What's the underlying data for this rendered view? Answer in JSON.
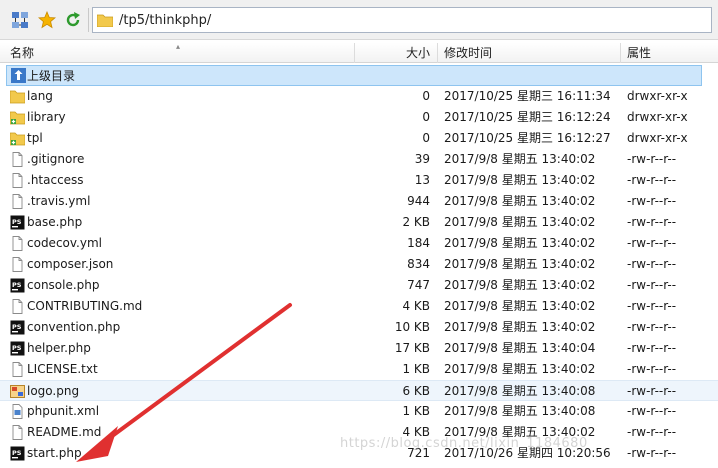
{
  "toolbar": {
    "path": "/tp5/thinkphp/",
    "icons": [
      "network-tree-icon",
      "favorite-star-icon",
      "refresh-icon",
      "folder-icon"
    ]
  },
  "columns": {
    "name": "名称",
    "size": "大小",
    "modified": "修改时间",
    "attributes": "属性"
  },
  "parent_dir": {
    "label": "上级目录"
  },
  "files": [
    {
      "name": "lang",
      "size": "0",
      "modified": "2017/10/25 星期三 16:11:34",
      "attr": "drwxr-xr-x",
      "icon": "folder"
    },
    {
      "name": "library",
      "size": "0",
      "modified": "2017/10/25 星期三 16:12:24",
      "attr": "drwxr-xr-x",
      "icon": "folder-plus"
    },
    {
      "name": "tpl",
      "size": "0",
      "modified": "2017/10/25 星期三 16:12:27",
      "attr": "drwxr-xr-x",
      "icon": "folder-plus"
    },
    {
      "name": ".gitignore",
      "size": "39",
      "modified": "2017/9/8 星期五 13:40:02",
      "attr": "-rw-r--r--",
      "icon": "file"
    },
    {
      "name": ".htaccess",
      "size": "13",
      "modified": "2017/9/8 星期五 13:40:02",
      "attr": "-rw-r--r--",
      "icon": "file"
    },
    {
      "name": ".travis.yml",
      "size": "944",
      "modified": "2017/9/8 星期五 13:40:02",
      "attr": "-rw-r--r--",
      "icon": "file"
    },
    {
      "name": "base.php",
      "size": "2 KB",
      "modified": "2017/9/8 星期五 13:40:02",
      "attr": "-rw-r--r--",
      "icon": "ps"
    },
    {
      "name": "codecov.yml",
      "size": "184",
      "modified": "2017/9/8 星期五 13:40:02",
      "attr": "-rw-r--r--",
      "icon": "file"
    },
    {
      "name": "composer.json",
      "size": "834",
      "modified": "2017/9/8 星期五 13:40:02",
      "attr": "-rw-r--r--",
      "icon": "file"
    },
    {
      "name": "console.php",
      "size": "747",
      "modified": "2017/9/8 星期五 13:40:02",
      "attr": "-rw-r--r--",
      "icon": "ps"
    },
    {
      "name": "CONTRIBUTING.md",
      "size": "4 KB",
      "modified": "2017/9/8 星期五 13:40:02",
      "attr": "-rw-r--r--",
      "icon": "file"
    },
    {
      "name": "convention.php",
      "size": "10 KB",
      "modified": "2017/9/8 星期五 13:40:02",
      "attr": "-rw-r--r--",
      "icon": "ps"
    },
    {
      "name": "helper.php",
      "size": "17 KB",
      "modified": "2017/9/8 星期五 13:40:04",
      "attr": "-rw-r--r--",
      "icon": "ps"
    },
    {
      "name": "LICENSE.txt",
      "size": "1 KB",
      "modified": "2017/9/8 星期五 13:40:02",
      "attr": "-rw-r--r--",
      "icon": "file"
    },
    {
      "name": "logo.png",
      "size": "6 KB",
      "modified": "2017/9/8 星期五 13:40:08",
      "attr": "-rw-r--r--",
      "icon": "image",
      "hover": true
    },
    {
      "name": "phpunit.xml",
      "size": "1 KB",
      "modified": "2017/9/8 星期五 13:40:08",
      "attr": "-rw-r--r--",
      "icon": "xml"
    },
    {
      "name": "README.md",
      "size": "4 KB",
      "modified": "2017/9/8 星期五 13:40:02",
      "attr": "-rw-r--r--",
      "icon": "file"
    },
    {
      "name": "start.php",
      "size": "721",
      "modified": "2017/10/26 星期四 10:20:56",
      "attr": "-rw-r--r--",
      "icon": "ps"
    }
  ],
  "watermark": "https://blog.csdn.net/lixin_1184680",
  "colors": {
    "selection": "#cde6fb",
    "folder": "#f2c94c",
    "arrow": "#e03030"
  }
}
